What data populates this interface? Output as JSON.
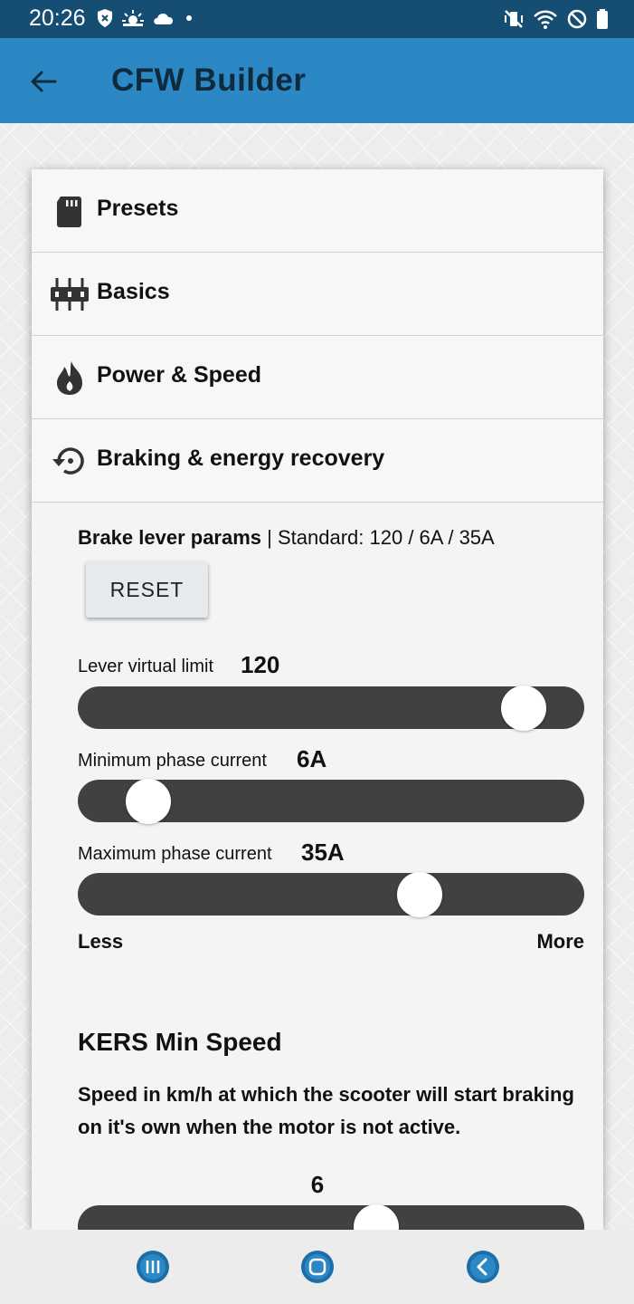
{
  "status_bar": {
    "time": "20:26",
    "left_icons": [
      "shield-icon",
      "weather-icon",
      "cloud-icon",
      "dot-icon"
    ],
    "right_icons": [
      "mute-vibrate-icon",
      "wifi-icon",
      "do-not-disturb-icon",
      "battery-icon"
    ]
  },
  "app_bar": {
    "title": "CFW Builder",
    "back_icon": "arrow-left-icon"
  },
  "accordion": [
    {
      "label": "Presets",
      "icon": "sd-card-icon"
    },
    {
      "label": "Basics",
      "icon": "sliders-icon"
    },
    {
      "label": "Power & Speed",
      "icon": "flame-icon"
    },
    {
      "label": "Braking & energy recovery",
      "icon": "restore-icon"
    }
  ],
  "brake": {
    "title": "Brake lever params",
    "separator": " | ",
    "standard": "Standard: 120 / 6A / 35A",
    "reset_label": "RESET",
    "sliders": [
      {
        "label": "Lever virtual limit",
        "value": "120",
        "fraction": 0.88
      },
      {
        "label": "Minimum phase current",
        "value": "6A",
        "fraction": 0.14
      },
      {
        "label": "Maximum phase current",
        "value": "35A",
        "fraction": 0.675
      }
    ],
    "less_label": "Less",
    "more_label": "More"
  },
  "kers": {
    "title": "KERS Min Speed",
    "description": "Speed in km/h at which the scooter will start braking on it's own when the motor is not active.",
    "value": "6",
    "fraction": 0.59
  },
  "nav_bar": {
    "icons": [
      "recents-icon",
      "home-icon",
      "back-icon"
    ],
    "accent": "#2b88c5"
  },
  "colors": {
    "status_bar": "#164d73",
    "app_bar": "#2b88c5",
    "slider_track": "#414141"
  }
}
